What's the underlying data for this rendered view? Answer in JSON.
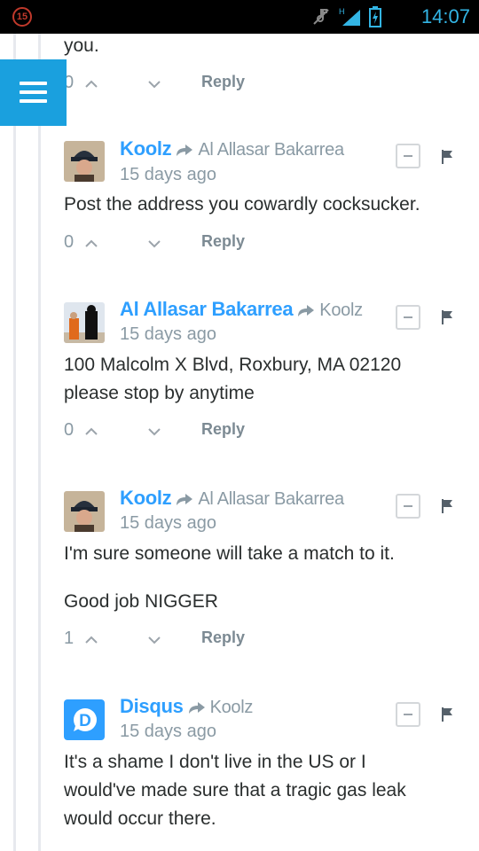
{
  "status_bar": {
    "notification_count": "15",
    "time": "14:07"
  },
  "top_fragment": {
    "text": "you.",
    "vote_count": "0",
    "reply_label": "Reply"
  },
  "comments": [
    {
      "author": "Koolz",
      "reply_to": "Al Allasar Bakarrea",
      "time": "15 days ago",
      "body": [
        "Post the address you cowardly cocksucker."
      ],
      "vote_count": "0",
      "reply_label": "Reply"
    },
    {
      "author": "Al Allasar Bakarrea",
      "reply_to": "Koolz",
      "time": "15 days ago",
      "body": [
        "100 Malcolm X Blvd, Roxbury, MA 02120",
        "please stop by anytime"
      ],
      "vote_count": "0",
      "reply_label": "Reply"
    },
    {
      "author": "Koolz",
      "reply_to": "Al Allasar Bakarrea",
      "time": "15 days ago",
      "body": [
        "I'm sure someone will take a match to it.",
        "",
        "Good job NIGGER"
      ],
      "vote_count": "1",
      "reply_label": "Reply"
    },
    {
      "author": "Disqus",
      "reply_to": "Koolz",
      "time": "15 days ago",
      "body": [
        "It's a shame I don't live in the US or I",
        "would've made sure that a tragic gas leak",
        "would occur there."
      ]
    }
  ],
  "colors": {
    "accent": "#1aa0de",
    "author": "#2e9fff",
    "muted": "#8a9aa4",
    "status_accent": "#33b5e5"
  }
}
